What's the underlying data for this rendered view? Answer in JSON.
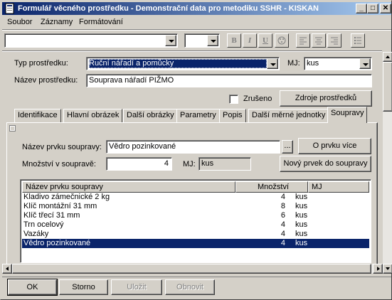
{
  "window": {
    "title": "Formulář věcného prostředku - Demonstrační data pro metodiku SSHR - KISKAN",
    "minimize": "_",
    "maximize": "□",
    "close": "✕"
  },
  "menu": [
    "Soubor",
    "Záznamy",
    "Formátování"
  ],
  "toolbar": {
    "bold": "B",
    "italic": "I",
    "underline": "U"
  },
  "form": {
    "type_label": "Typ prostředku:",
    "type_value": "Ruční nářadí a pomůcky",
    "unit_label": "MJ:",
    "unit_value": "kus",
    "name_label": "Název prostředku:",
    "name_value": "Souprava nářadí PIŽMO",
    "cancelled_label": "Zrušeno",
    "sources_button": "Zdroje prostředků"
  },
  "tabs": [
    {
      "label": "Identifikace"
    },
    {
      "label": "Hlavní obrázek"
    },
    {
      "label": "Další obrázky"
    },
    {
      "label": "Parametry"
    },
    {
      "label": "Popis"
    },
    {
      "label": "Další měrné jednotky"
    },
    {
      "label": "Soupravy"
    }
  ],
  "active_tab": "Soupravy",
  "kit": {
    "item_name_label": "Název prvku soupravy:",
    "item_name_value": "Vědro pozinkované",
    "browse_button": "...",
    "item_more_button": "O prvku více",
    "quantity_label": "Množství v soupravě:",
    "quantity_value": "4",
    "unit_label": "MJ:",
    "unit_value": "kus",
    "new_item_button": "Nový prvek do soupravy",
    "columns": [
      "Název prvku soupravy",
      "Množství",
      "MJ"
    ],
    "rows": [
      {
        "name": "Kladivo zámečnické 2 kg",
        "qty": "4",
        "unit": "kus"
      },
      {
        "name": "Klíč montážní 31 mm",
        "qty": "8",
        "unit": "kus"
      },
      {
        "name": "Klíč třecí 31 mm",
        "qty": "6",
        "unit": "kus"
      },
      {
        "name": "Trn ocelový",
        "qty": "4",
        "unit": "kus"
      },
      {
        "name": "Vazáky",
        "qty": "4",
        "unit": "kus"
      },
      {
        "name": "Vědro pozinkované",
        "qty": "4",
        "unit": "kus"
      }
    ],
    "selected_row": "Vědro pozinkované"
  },
  "footer": {
    "ok": "OK",
    "cancel": "Storno",
    "save": "Uložit",
    "refresh": "Obnovit"
  },
  "colors": {
    "titlebar_start": "#0a246a",
    "titlebar_end": "#a6caf0",
    "selection": "#0a246a",
    "face": "#d4d0c8"
  }
}
